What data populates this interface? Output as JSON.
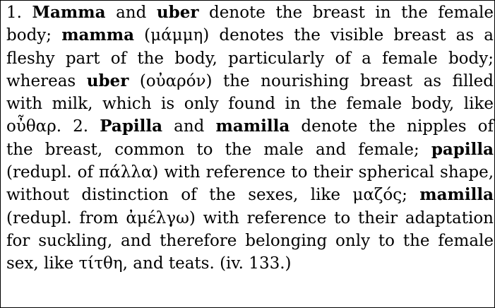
{
  "entry": {
    "lines": [
      [
        "1. ",
        {
          "b": "Mamma"
        },
        " and ",
        {
          "b": "uber"
        },
        " denote the breast in the female"
      ],
      [
        "body; ",
        {
          "b": "mamma"
        },
        " (μάμμη) denotes the visible breast as a"
      ],
      [
        "fleshy part of the body, particularly of a female body;"
      ],
      [
        "whereas ",
        {
          "b": "uber"
        },
        " (οὐαρόν) the nourishing breast as filled"
      ],
      [
        "with milk, which is only found in the female body, like"
      ],
      [
        "οὖθαρ. 2. ",
        {
          "b": "Papilla"
        },
        " and ",
        {
          "b": "mamilla"
        },
        " denote the nipples of"
      ],
      [
        "the breast, common to the male and female; ",
        {
          "b": "papilla"
        }
      ],
      [
        "(redupl. of πάλλα) with reference to their spherical shape,"
      ],
      [
        "without distinction of the sexes, like μαζός; ",
        {
          "b": "mamilla"
        }
      ],
      [
        "(redupl. from ἀμέλγω) with reference to their adaptation"
      ],
      [
        "for suckling, and therefore belonging only to the female"
      ],
      [
        "sex, like τίτθη, and teats. (iv. 133.)"
      ]
    ]
  }
}
